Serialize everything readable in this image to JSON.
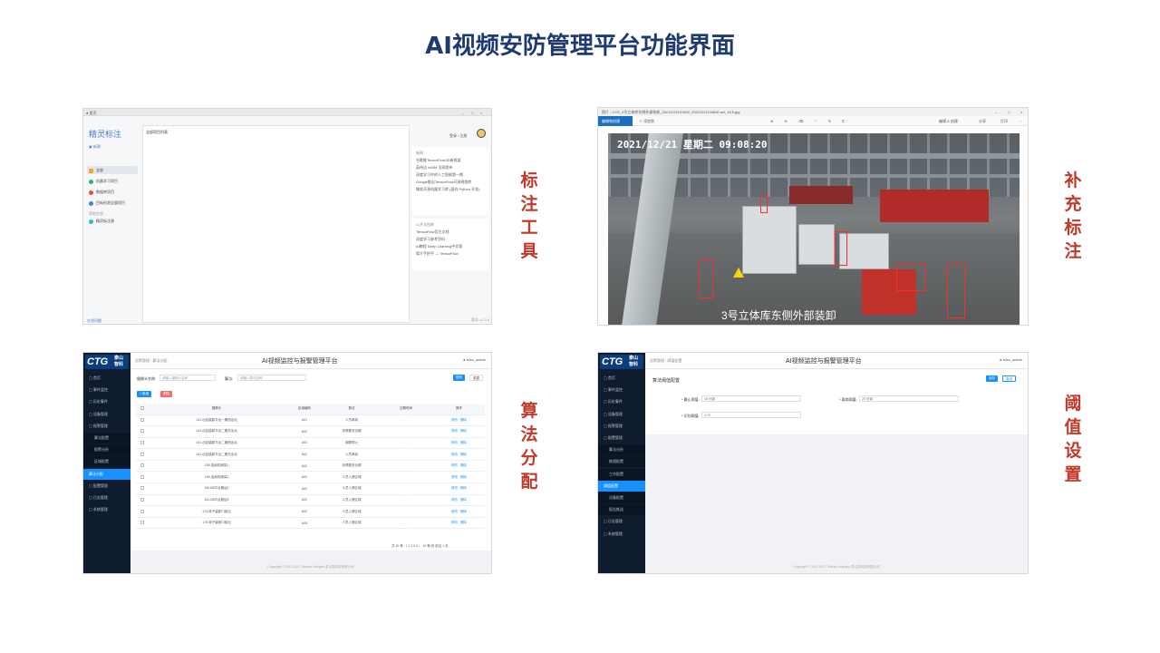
{
  "page_title": "AI视频安防管理平台功能界面",
  "labels": {
    "annotation_tool": "标注工具",
    "supplement_annotation": "补充标注",
    "algorithm_assignment": "算法分配",
    "threshold_settings": "阈值设置"
  },
  "shot1": {
    "tab": "● 首页",
    "logo": "精灵标注",
    "new_button": "新建",
    "menu": [
      "全部",
      "机器学习项目",
      "数据库项目",
      "目标检测全量项目"
    ],
    "section": "帮助信息",
    "help_item": "精灵标注源",
    "main_header": "全部项目列表",
    "user": "登录 / 注册",
    "card1_title": "新闻",
    "card1_items": [
      "谷歌推TensorFlow3D新框架",
      "英伟达 ioWM 全网发布",
      "深度学习中的人工智能第一期",
      "Google推出TensorFlow开源视频库",
      "微软开源机器学习库 (面向 Python 开发)"
    ],
    "card2_title": "公开文档库",
    "card2_items": [
      "TensorFlow官方文档",
      "深度学习参考资料",
      "AI教程 Deep Learning中文版",
      "简介手把手 — TensorFlow"
    ],
    "footer_left": "在线问题",
    "footer_right": "版本 v1.0.4"
  },
  "shot2": {
    "file_title": "照片 - CVS_3号立体库东侧外部装卸_20211221101600_20211221104600.avi_18.5.jpg",
    "edit_button": "编辑和创建",
    "add_button": "添加到",
    "timestamp": "2021/12/21 星期二 09:08:20",
    "caption": "3号立体库东侧外部装卸",
    "right_tools": [
      "编辑 & 创建",
      "分享",
      "打印"
    ]
  },
  "shot3": {
    "logo": "CTG",
    "logo_cn": "泰山 智科",
    "breadcrumb": "告警管理 / 算法分配",
    "title": "AI视频监控与报警管理平台",
    "user": "tslcu_admin",
    "sidebar": [
      {
        "label": "首页",
        "type": "main"
      },
      {
        "label": "事件监控",
        "type": "main"
      },
      {
        "label": "历史事件",
        "type": "main"
      },
      {
        "label": "设备管理",
        "type": "main"
      },
      {
        "label": "报警管理",
        "type": "main"
      },
      {
        "label": "算法配置",
        "type": "sub"
      },
      {
        "label": "报警分析",
        "type": "sub"
      },
      {
        "label": "区域配置",
        "type": "sub"
      },
      {
        "label": "算法分配",
        "type": "active"
      },
      {
        "label": "配置管理",
        "type": "main"
      },
      {
        "label": "日志管理",
        "type": "main"
      },
      {
        "label": "系统管理",
        "type": "main"
      }
    ],
    "search_label1": "摄像头名称:",
    "search_ph1": "请输入摄像头名称",
    "search_label2": "算法:",
    "search_ph2": "请输入算法名称",
    "btn_search": "搜索",
    "btn_reset": "重置",
    "btn_add": "+ 新增",
    "btn_delete": "删除",
    "columns": [
      "摄像头",
      "区域编码",
      "算法",
      "过期时间",
      "操作"
    ],
    "rows": [
      [
        "141-出站装卸平台一期西出北",
        "A01",
        "人员串岗",
        "-"
      ],
      [
        "141-出站装卸平台二期东出北",
        "A02",
        "未佩戴安全帽",
        "-"
      ],
      [
        "141-出站装卸平台二期西出北",
        "A01",
        "烟雾明火",
        "-"
      ],
      [
        "141-出站装卸平台二期东出北",
        "A02",
        "人员串岗",
        "-"
      ],
      [
        "159-连续机械臂1",
        "A02",
        "未佩戴安全帽",
        "-"
      ],
      [
        "159-连续机械臂1",
        "A02",
        "人员入侵区域",
        "-"
      ],
      [
        "160-B8平台搬运1",
        "A02",
        "人员入侵区域",
        "-"
      ],
      [
        "161-B8平台搬运2",
        "A02",
        "人员入侵区域",
        "-"
      ],
      [
        "174-转子装卸口前出",
        "A02",
        "人员入侵区域",
        "-"
      ],
      [
        "175-转子装卸口前出",
        "A03",
        "人员入侵区域",
        "-"
      ]
    ],
    "op_edit": "修改",
    "op_del": "删除",
    "pagination": "共 40 条  〈 1 2 3 4 〉 10 条/页  前往  1  页",
    "footer": "Copyright © 2011-2021 Taishan Wangbo 泰山智科技有限公司"
  },
  "shot4": {
    "logo": "CTG",
    "logo_cn": "泰山 智科",
    "breadcrumb": "告警管理 / 阈值配置",
    "title": "AI视频监控与报警管理平台",
    "user": "tslcu_admin",
    "sidebar": [
      {
        "label": "首页",
        "type": "main"
      },
      {
        "label": "事件监控",
        "type": "main"
      },
      {
        "label": "历史事件",
        "type": "main"
      },
      {
        "label": "设备管理",
        "type": "main"
      },
      {
        "label": "报警管理",
        "type": "main"
      },
      {
        "label": "配置管理",
        "type": "main"
      },
      {
        "label": "算法分析",
        "type": "sub"
      },
      {
        "label": "推理配置",
        "type": "sub"
      },
      {
        "label": "工作配置",
        "type": "sub"
      },
      {
        "label": "阈值配置",
        "type": "active"
      },
      {
        "label": "设备配置",
        "type": "sub"
      },
      {
        "label": "报告推送",
        "type": "sub"
      },
      {
        "label": "日志管理",
        "type": "main"
      },
      {
        "label": "系统管理",
        "type": "main"
      }
    ],
    "section_title": "算法阈值配置",
    "btn_save": "保存",
    "btn_cancel": "取消",
    "field1_label": "* 静止阈值:",
    "field1_value": "15 分钟",
    "field2_label": "* 离岗阈值:",
    "field2_value": "20 分钟",
    "field3_label": "* 识别阈值:",
    "field3_value": "0.70",
    "footer": "Copyright © 2011-2021 Taishan Wangbo 泰山智科技有限公司"
  },
  "colors": {
    "title": "#1f3a70",
    "label": "#c0392b",
    "sidebar": "#0f1c2e",
    "accent": "#1890ff"
  }
}
